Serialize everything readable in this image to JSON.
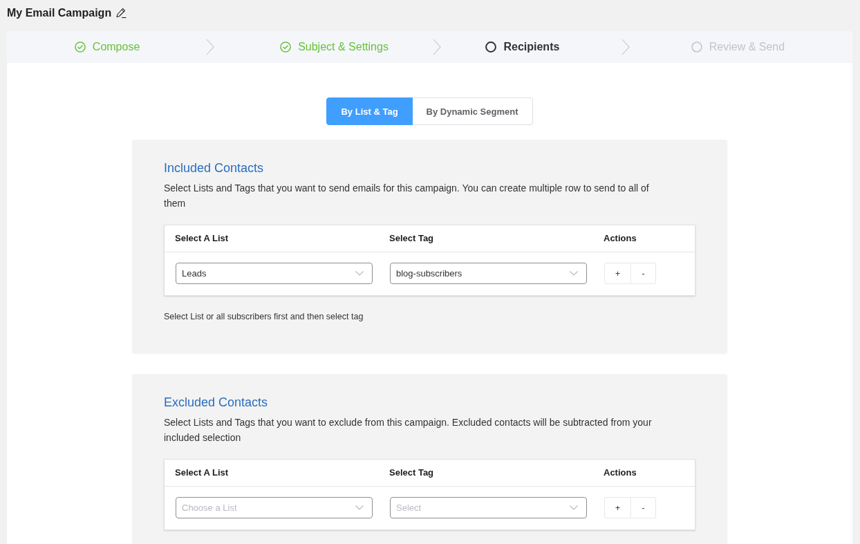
{
  "page_title": "My Email Campaign",
  "steps": [
    {
      "label": "Compose",
      "completed": true,
      "active": false
    },
    {
      "label": "Subject & Settings",
      "completed": true,
      "active": false
    },
    {
      "label": "Recipients",
      "completed": false,
      "active": true
    },
    {
      "label": "Review & Send",
      "completed": false,
      "active": false
    }
  ],
  "tabs": [
    {
      "label": "By List & Tag",
      "selected": true
    },
    {
      "label": "By Dynamic Segment",
      "selected": false
    }
  ],
  "sections": [
    {
      "title": "Included Contacts",
      "description": "Select Lists and Tags that you want to send emails for this campaign. You can create multiple row to send to all of them",
      "table": {
        "columns": [
          "Select A List",
          "Select Tag",
          "Actions"
        ],
        "rows": [
          {
            "list": {
              "value": "Leads"
            },
            "tag": {
              "value": "blog-subscribers"
            },
            "actions": [
              "+",
              "-"
            ]
          }
        ]
      },
      "hint": "Select List or all subscribers first and then select tag"
    },
    {
      "title": "Excluded Contacts",
      "description": "Select Lists and Tags that you want to exclude from this campaign. Excluded contacts will be subtracted from your included selection",
      "table": {
        "columns": [
          "Select A List",
          "Select Tag",
          "Actions"
        ],
        "rows": [
          {
            "list": {
              "placeholder": "Choose a List"
            },
            "tag": {
              "placeholder": "Select"
            },
            "actions": [
              "+",
              "-"
            ]
          }
        ]
      }
    }
  ]
}
